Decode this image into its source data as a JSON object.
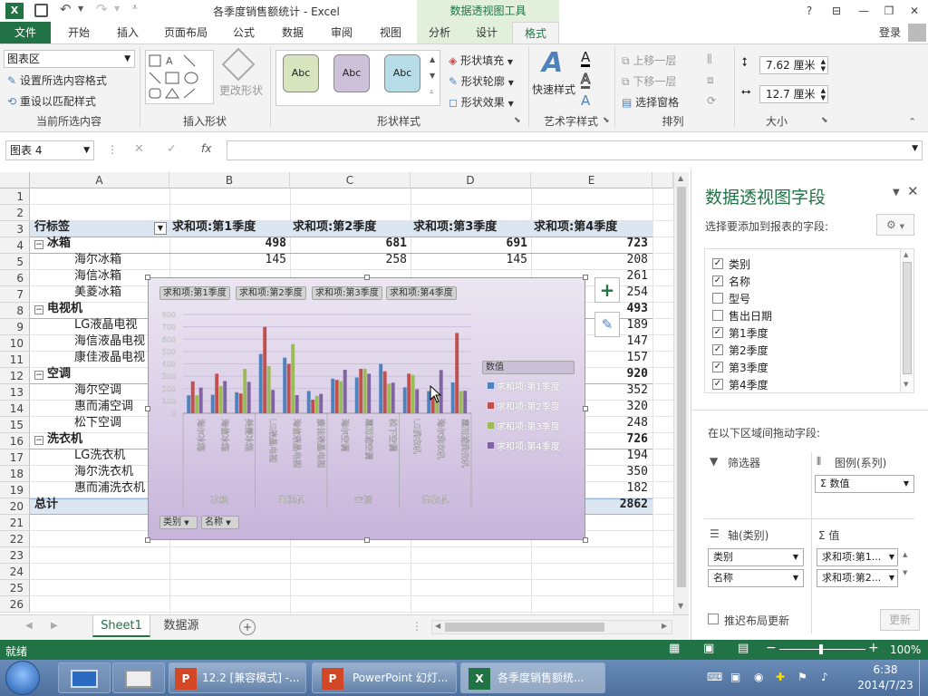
{
  "titlebar": {
    "title": "各季度销售额统计 - Excel",
    "context_tools": "数据透视图工具",
    "help": "?",
    "minimize": "—",
    "restore": "❐",
    "close": "✕"
  },
  "tabs": {
    "file": "文件",
    "home": "开始",
    "insert": "插入",
    "page_layout": "页面布局",
    "formulas": "公式",
    "data": "数据",
    "review": "审阅",
    "view": "视图",
    "analyze": "分析",
    "design": "设计",
    "format": "格式",
    "login": "登录"
  },
  "ribbon": {
    "current_selection": {
      "dropdown_value": "图表区",
      "format_selection": "设置所选内容格式",
      "reset_style": "重设以匹配样式",
      "label": "当前所选内容"
    },
    "insert_shapes": {
      "change_shape": "更改形状",
      "label": "插入形状"
    },
    "shape_styles": {
      "abc": [
        "Abc",
        "Abc",
        "Abc"
      ],
      "fill": "形状填充",
      "outline": "形状轮廓",
      "effects": "形状效果",
      "label": "形状样式"
    },
    "wordart": {
      "quick_styles": "快速样式",
      "label": "艺术字样式"
    },
    "arrange": {
      "bring_forward": "上移一层",
      "send_backward": "下移一层",
      "selection_pane": "选择窗格",
      "label": "排列"
    },
    "size": {
      "height": "7.62 厘米",
      "width": "12.7 厘米",
      "label": "大小"
    }
  },
  "formula_bar": {
    "name_box": "图表 4",
    "fx": "fx"
  },
  "sheet": {
    "columns": [
      "A",
      "B",
      "C",
      "D",
      "E"
    ],
    "rows": [
      "1",
      "2",
      "3",
      "4",
      "5",
      "6",
      "7",
      "8",
      "9",
      "10",
      "11",
      "12",
      "13",
      "14",
      "15",
      "16",
      "17",
      "18",
      "19",
      "20",
      "21",
      "22",
      "23",
      "24",
      "25",
      "26"
    ],
    "header": [
      "行标签",
      "求和项:第1季度",
      "求和项:第2季度",
      "求和项:第3季度",
      "求和项:第4季度"
    ],
    "data_rows": [
      {
        "row": 4,
        "label": "冰箱",
        "group": true,
        "values": [
          "498",
          "681",
          "691",
          "723"
        ]
      },
      {
        "row": 5,
        "label": "海尔冰箱",
        "group": false,
        "values": [
          "145",
          "258",
          "145",
          "208"
        ]
      },
      {
        "row": 6,
        "label": "海信冰箱",
        "group": false,
        "values": [
          "",
          "",
          "",
          "261"
        ]
      },
      {
        "row": 7,
        "label": "美菱冰箱",
        "group": false,
        "values": [
          "",
          "",
          "",
          "254"
        ]
      },
      {
        "row": 8,
        "label": "电视机",
        "group": true,
        "values": [
          "",
          "",
          "",
          "493"
        ]
      },
      {
        "row": 9,
        "label": "LG液晶电视",
        "group": false,
        "values": [
          "",
          "",
          "",
          "189"
        ]
      },
      {
        "row": 10,
        "label": "海信液晶电视",
        "group": false,
        "values": [
          "",
          "",
          "",
          "147"
        ]
      },
      {
        "row": 11,
        "label": "康佳液晶电视",
        "group": false,
        "values": [
          "",
          "",
          "",
          "157"
        ]
      },
      {
        "row": 12,
        "label": "空调",
        "group": true,
        "values": [
          "",
          "",
          "",
          "920"
        ]
      },
      {
        "row": 13,
        "label": "海尔空调",
        "group": false,
        "values": [
          "",
          "",
          "",
          "352"
        ]
      },
      {
        "row": 14,
        "label": "惠而浦空调",
        "group": false,
        "values": [
          "",
          "",
          "",
          "320"
        ]
      },
      {
        "row": 15,
        "label": "松下空调",
        "group": false,
        "values": [
          "",
          "",
          "",
          "248"
        ]
      },
      {
        "row": 16,
        "label": "洗衣机",
        "group": true,
        "values": [
          "",
          "",
          "",
          "726"
        ]
      },
      {
        "row": 17,
        "label": "LG洗衣机",
        "group": false,
        "values": [
          "",
          "",
          "",
          "194"
        ]
      },
      {
        "row": 18,
        "label": "海尔洗衣机",
        "group": false,
        "values": [
          "",
          "",
          "",
          "350"
        ]
      },
      {
        "row": 19,
        "label": "惠而浦洗衣机",
        "group": false,
        "values": [
          "",
          "",
          "",
          "182"
        ]
      },
      {
        "row": 20,
        "label": "总计",
        "group": true,
        "values": [
          "",
          "",
          "",
          "2862"
        ]
      }
    ]
  },
  "chart": {
    "field_buttons": [
      "求和项:第1季度",
      "求和项:第2季度",
      "求和项:第3季度",
      "求和项:第4季度"
    ],
    "axis_buttons": [
      "类别",
      "名称"
    ],
    "legend_title": "数值",
    "groups": [
      "冰箱",
      "电视机",
      "空调",
      "洗衣机"
    ]
  },
  "chart_data": {
    "type": "bar",
    "categories": [
      "海尔冰箱",
      "海信冰箱",
      "美菱冰箱",
      "LG液晶电视",
      "海信液晶电视",
      "康佳液晶电视",
      "海尔空调",
      "惠而浦空调",
      "松下空调",
      "LG洗衣机",
      "海尔洗衣机",
      "惠而浦洗衣机"
    ],
    "groups": [
      {
        "name": "冰箱",
        "count": 3
      },
      {
        "name": "电视机",
        "count": 3
      },
      {
        "name": "空调",
        "count": 3
      },
      {
        "name": "洗衣机",
        "count": 3
      }
    ],
    "series": [
      {
        "name": "求和项:第1季度",
        "color": "#4f81bd",
        "values": [
          145,
          150,
          170,
          480,
          450,
          180,
          280,
          290,
          400,
          210,
          180,
          250
        ]
      },
      {
        "name": "求和项:第2季度",
        "color": "#c0504d",
        "values": [
          258,
          320,
          160,
          700,
          400,
          110,
          270,
          360,
          340,
          320,
          190,
          650
        ]
      },
      {
        "name": "求和项:第3季度",
        "color": "#9bbb59",
        "values": [
          145,
          220,
          360,
          380,
          560,
          140,
          260,
          360,
          240,
          310,
          160,
          180
        ]
      },
      {
        "name": "求和项:第4季度",
        "color": "#8064a2",
        "values": [
          208,
          261,
          254,
          189,
          147,
          157,
          352,
          320,
          248,
          194,
          350,
          182
        ]
      }
    ],
    "yticks": [
      "0",
      "100",
      "200",
      "300",
      "400",
      "500",
      "600",
      "700",
      "800"
    ],
    "ylim": [
      0,
      800
    ],
    "legend_placement": "right"
  },
  "pane": {
    "title": "数据透视图字段",
    "subtitle": "选择要添加到报表的字段:",
    "fields": [
      {
        "name": "类别",
        "checked": "✓"
      },
      {
        "name": "名称",
        "checked": "✓"
      },
      {
        "name": "型号",
        "checked": ""
      },
      {
        "name": "售出日期",
        "checked": ""
      },
      {
        "name": "第1季度",
        "checked": "✓"
      },
      {
        "name": "第2季度",
        "checked": "✓"
      },
      {
        "name": "第3季度",
        "checked": "✓"
      },
      {
        "name": "第4季度",
        "checked": "✓"
      }
    ],
    "drag_hint": "在以下区域间拖动字段:",
    "filters": "筛选器",
    "legend_series": "图例(系列)",
    "legend_item": "Σ 数值",
    "axis_category": "轴(类别)",
    "values_label": "Σ 值",
    "axis_items": [
      "类别",
      "名称"
    ],
    "value_items": [
      "求和项:第1...",
      "求和项:第2..."
    ],
    "defer_update": "推迟布局更新",
    "update_button": "更新"
  },
  "sheet_tabs": [
    "Sheet1",
    "数据源"
  ],
  "status": {
    "ready": "就绪",
    "zoom": "100%"
  },
  "taskbar": {
    "items": [
      "12.2 [兼容模式] -...",
      "PowerPoint 幻灯...",
      "各季度销售额统..."
    ],
    "time": "6:38",
    "date": "2014/7/23"
  },
  "colors": {
    "excel_green": "#217346",
    "pivot_tab_bg": "#e2efda"
  }
}
